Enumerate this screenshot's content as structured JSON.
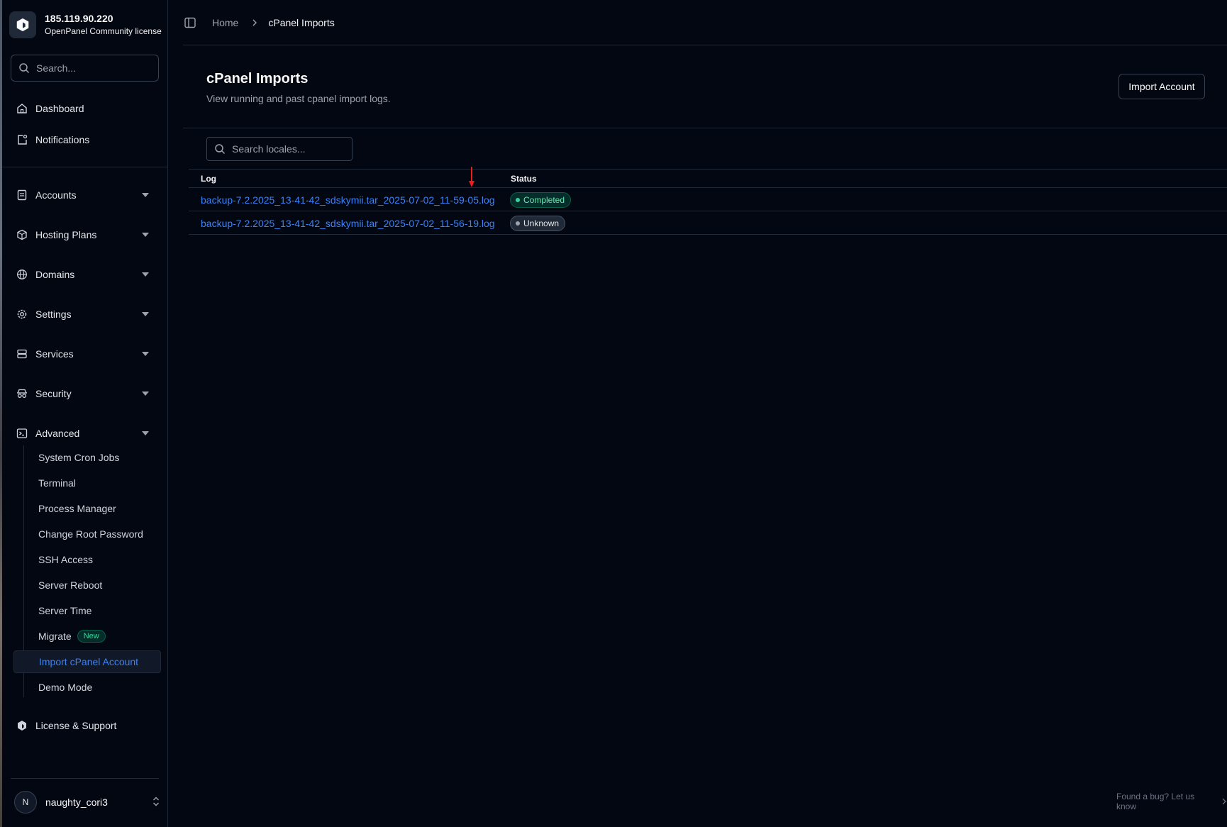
{
  "brand": {
    "title": "185.119.90.220",
    "subtitle": "OpenPanel Community license"
  },
  "sidebar": {
    "search_placeholder": "Search...",
    "top_items": [
      {
        "label": "Dashboard",
        "icon": "home-icon"
      },
      {
        "label": "Notifications",
        "icon": "bell-icon"
      }
    ],
    "groups": [
      {
        "label": "Accounts",
        "icon": "user-card-icon"
      },
      {
        "label": "Hosting Plans",
        "icon": "box-icon"
      },
      {
        "label": "Domains",
        "icon": "globe-icon"
      },
      {
        "label": "Settings",
        "icon": "gear-icon"
      },
      {
        "label": "Services",
        "icon": "server-icon"
      },
      {
        "label": "Security",
        "icon": "spy-glasses-icon"
      },
      {
        "label": "Advanced",
        "icon": "terminal-icon"
      }
    ],
    "advanced_items": [
      {
        "label": "System Cron Jobs"
      },
      {
        "label": "Terminal"
      },
      {
        "label": "Process Manager"
      },
      {
        "label": "Change Root Password"
      },
      {
        "label": "SSH Access"
      },
      {
        "label": "Server Reboot"
      },
      {
        "label": "Server Time"
      },
      {
        "label": "Migrate",
        "badge": "New"
      },
      {
        "label": "Import cPanel Account",
        "active": true
      },
      {
        "label": "Demo Mode"
      }
    ],
    "license_item": {
      "label": "License & Support",
      "icon": "openpanel-logo-icon"
    },
    "user": {
      "initial": "N",
      "name": "naughty_cori3"
    }
  },
  "breadcrumb": {
    "home": "Home",
    "current": "cPanel Imports"
  },
  "page": {
    "title": "cPanel Imports",
    "subtitle": "View running and past cpanel import logs.",
    "import_button": "Import Account",
    "search_placeholder": "Search locales..."
  },
  "table": {
    "columns": [
      "Log",
      "Status"
    ],
    "rows": [
      {
        "log": "backup-7.2.2025_13-41-42_sdskymii.tar_2025-07-02_11-59-05.log",
        "status": "Completed"
      },
      {
        "log": "backup-7.2.2025_13-41-42_sdskymii.tar_2025-07-02_11-56-19.log",
        "status": "Unknown"
      }
    ]
  },
  "footer": {
    "bug_link": "Found a bug? Let us know"
  },
  "colors": {
    "background": "#030712",
    "accent_link": "#3b82f6",
    "completed": "#34d399",
    "annotation_arrow": "#ef1c1c"
  }
}
